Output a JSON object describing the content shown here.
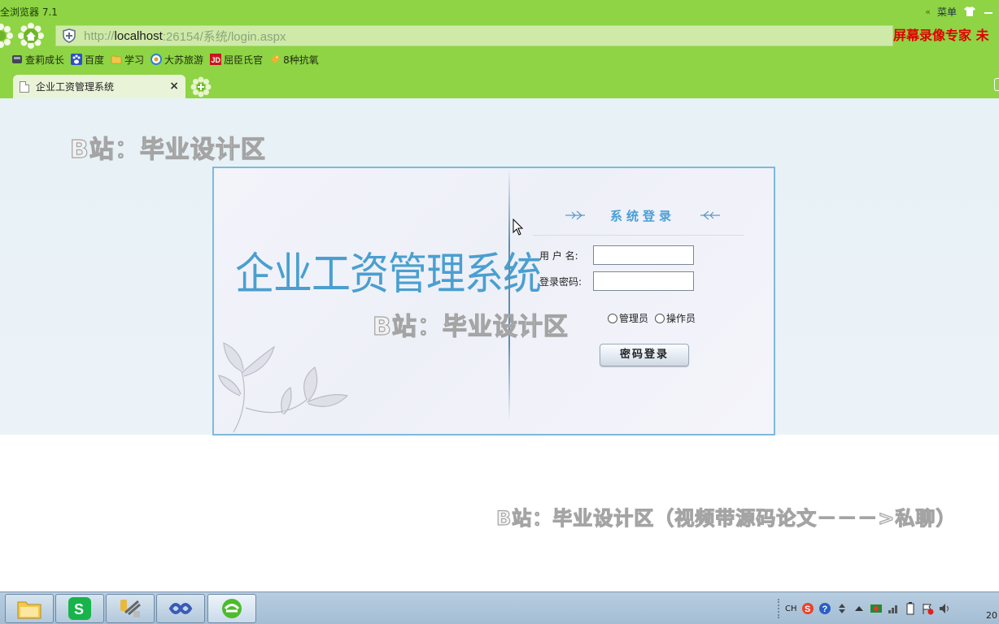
{
  "browser": {
    "app_title": "全浏览器 7.1",
    "menu_label": "菜单",
    "url_prefix": "http://",
    "url_host": "localhost",
    "url_rest": ":26154/系统/login.aspx",
    "recorder_text": "屏幕录像专家  未",
    "bookmarks": [
      {
        "label": "查莉成长",
        "icon": "bookmark-icon"
      },
      {
        "label": "百度",
        "icon": "baidu-paw-icon"
      },
      {
        "label": "学习",
        "icon": "folder-icon"
      },
      {
        "label": "大苏旅游",
        "icon": "globe-icon"
      },
      {
        "label": "屈臣氏官",
        "icon": "jd-icon"
      },
      {
        "label": "8种抗氧",
        "icon": "tag-icon"
      }
    ],
    "tab": {
      "label": "企业工资管理系统",
      "close": "×"
    }
  },
  "page": {
    "watermark_top": "B站：毕业设计区",
    "watermark_mid": "B站：毕业设计区",
    "watermark_bottom": "B站：毕业设计区（视频带源码论文－－－>私聊）",
    "system_title": "企业工资管理系统",
    "login": {
      "title": "系统登录",
      "username_label": "用 户 名:",
      "username_value": "",
      "password_label": "登录密码:",
      "password_value": "",
      "role_admin": "管理员",
      "role_operator": "操作员",
      "submit": "密码登录"
    }
  },
  "taskbar": {
    "ime": "CH",
    "clock": "20"
  },
  "colors": {
    "chrome_green": "#8ed444",
    "title_blue": "#4a9fd0",
    "recorder_red": "#e00000",
    "panel_border": "#7eb9dc"
  }
}
